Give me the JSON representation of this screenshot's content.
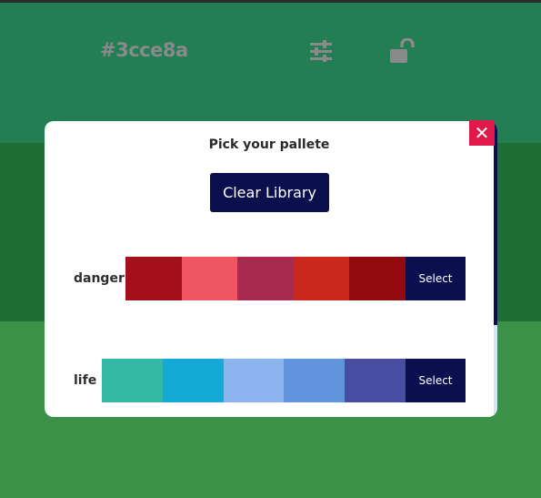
{
  "colors": {
    "top_line": "#2b2b2b",
    "header_bg": "#237e54",
    "mid_bg": "#1f6e33",
    "bottom_bg": "#3b9147",
    "modal_bg": "#ffffff",
    "accent_navy": "#0b0f4e",
    "close_red": "#e0194a"
  },
  "header": {
    "hex_value": "#3cce8a",
    "adjust_icon": "sliders-icon",
    "lock_icon": "unlocked-padlock-icon"
  },
  "modal": {
    "title": "Pick your pallete",
    "clear_button_label": "Clear Library",
    "close_icon": "close-x-icon",
    "close_glyph": "✕",
    "palettes": [
      {
        "name": "danger",
        "colors": [
          "#a3101a",
          "#ef5662",
          "#a82a4e",
          "#c9281a",
          "#920a0d"
        ],
        "select_label": "Select"
      },
      {
        "name": "life",
        "colors": [
          "#33b9a5",
          "#15a9d8",
          "#8cb5f0",
          "#6095dd",
          "#474ea1"
        ],
        "select_label": "Select"
      }
    ]
  }
}
